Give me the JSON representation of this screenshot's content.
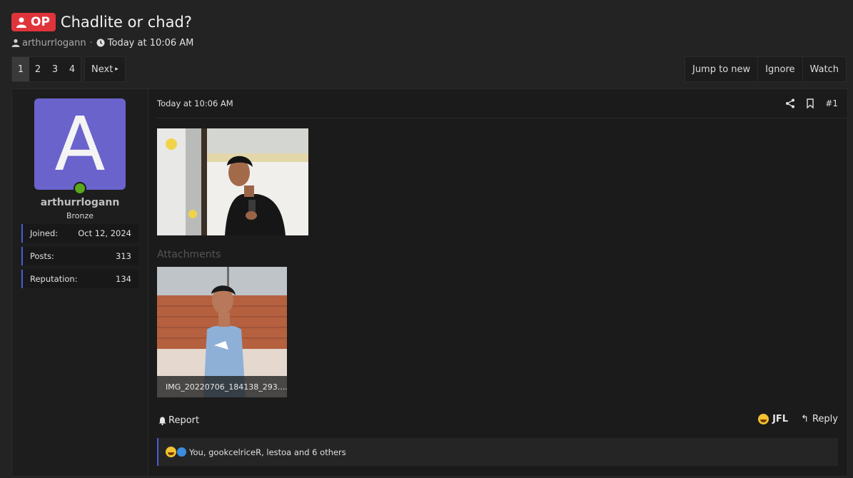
{
  "thread": {
    "badge": "OP",
    "title": "Chadlite or chad?",
    "author": "arthurrlogann",
    "date": "Today at 10:06 AM"
  },
  "pagination": {
    "pages": [
      "1",
      "2",
      "3",
      "4"
    ],
    "current": "1",
    "next_label": "Next"
  },
  "thread_actions": [
    "Jump to new",
    "Ignore",
    "Watch"
  ],
  "post": {
    "user": {
      "avatar_letter": "A",
      "username": "arthurrlogann",
      "rank": "Bronze",
      "stats": [
        {
          "label": "Joined:",
          "value": "Oct 12, 2024"
        },
        {
          "label": "Posts:",
          "value": "313"
        },
        {
          "label": "Reputation:",
          "value": "134"
        }
      ],
      "colors": {
        "avatar": "#6b63cc",
        "online": "#5aa61c"
      }
    },
    "date": "Today at 10:06 AM",
    "number": "#1",
    "attachments_title": "Attachments",
    "attachment_filename": "IMG_20220706_184138_293....",
    "report_label": "Report",
    "jfl_label": "JFL",
    "reply_label": "Reply",
    "reactions_text": "You, gookcelriceR, lestoa and 6 others"
  },
  "icons": [
    "user-icon",
    "clock-icon",
    "share-icon",
    "bookmark-icon",
    "bell-icon",
    "reply-arrow-icon",
    "crying-laugh-emoji-icon",
    "like-icon"
  ],
  "colors": {
    "badge": "#e0343b",
    "accent": "#4a5cd6",
    "background": "#232323"
  }
}
